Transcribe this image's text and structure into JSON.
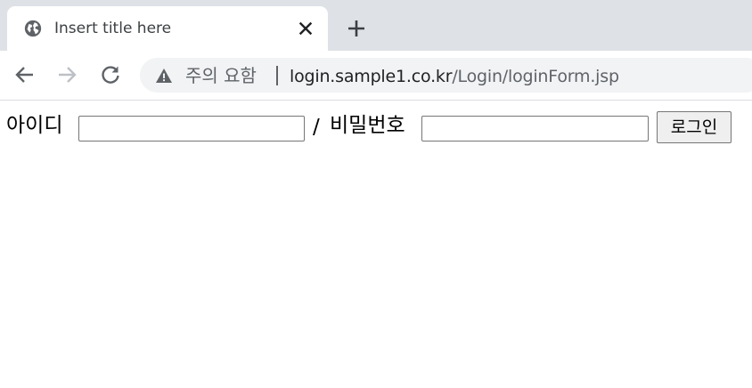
{
  "tab": {
    "title": "Insert title here",
    "favicon": "globe-icon",
    "close_icon": "close-icon"
  },
  "new_tab_icon": "plus-icon",
  "toolbar": {
    "back_icon": "back-arrow-icon",
    "forward_icon": "forward-arrow-icon",
    "reload_icon": "reload-icon"
  },
  "omnibox": {
    "security_icon": "warning-triangle-icon",
    "security_label": "주의 요함",
    "url_host": "login.sample1.co.kr",
    "url_path": "/Login/loginForm.jsp"
  },
  "form": {
    "id_label": "아이디",
    "id_value": "",
    "separator": "/",
    "password_label": "비밀번호",
    "password_value": "",
    "submit_label": "로그인"
  },
  "colors": {
    "tabstrip_bg": "#dee1e6",
    "omnibox_bg": "#f1f3f4",
    "icon_gray": "#5f6368",
    "forward_disabled": "#bdc1c6",
    "button_bg": "#efefef"
  }
}
